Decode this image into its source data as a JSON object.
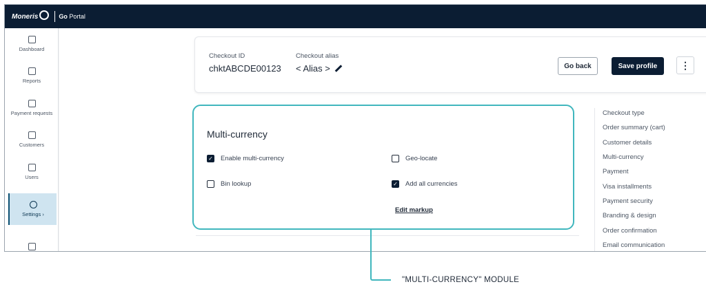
{
  "header": {
    "brand": "Moneris",
    "portal_prefix": "Go",
    "portal_suffix": "Portal"
  },
  "sidebar": {
    "items": [
      {
        "label": "Dashboard",
        "icon": "dashboard-icon"
      },
      {
        "label": "Reports",
        "icon": "reports-icon"
      },
      {
        "label": "Payment requests",
        "icon": "payment-requests-icon"
      },
      {
        "label": "Customers",
        "icon": "customers-icon"
      },
      {
        "label": "Users",
        "icon": "users-icon"
      },
      {
        "label": "Settings ›",
        "icon": "gear-icon",
        "active": true
      },
      {
        "label": "",
        "icon": "more-app-icon"
      }
    ]
  },
  "profile": {
    "checkout_id_label": "Checkout ID",
    "checkout_id_value": "chktABCDE00123",
    "alias_label": "Checkout alias",
    "alias_value": "< Alias >",
    "go_back_label": "Go back",
    "save_label": "Save profile",
    "more_label": "⋮"
  },
  "module": {
    "title": "Multi-currency",
    "options": [
      {
        "label": "Enable multi-currency",
        "checked": true
      },
      {
        "label": "Geo-locate",
        "checked": false
      },
      {
        "label": "Bin lookup",
        "checked": false
      },
      {
        "label": "Add all currencies",
        "checked": true
      }
    ],
    "edit_markup_label": "Edit markup"
  },
  "anchors": [
    "Checkout type",
    "Order summary (cart)",
    "Customer details",
    "Multi-currency",
    "Payment",
    "Visa installments",
    "Payment security",
    "Branding & design",
    "Order confirmation",
    "Email communication"
  ],
  "callout": {
    "text": "\"MULTI-CURRENCY\" MODULE"
  },
  "colors": {
    "navy": "#0b1d33",
    "highlight": "#3fb6bd",
    "active_nav_bg": "#cfe4f0"
  }
}
